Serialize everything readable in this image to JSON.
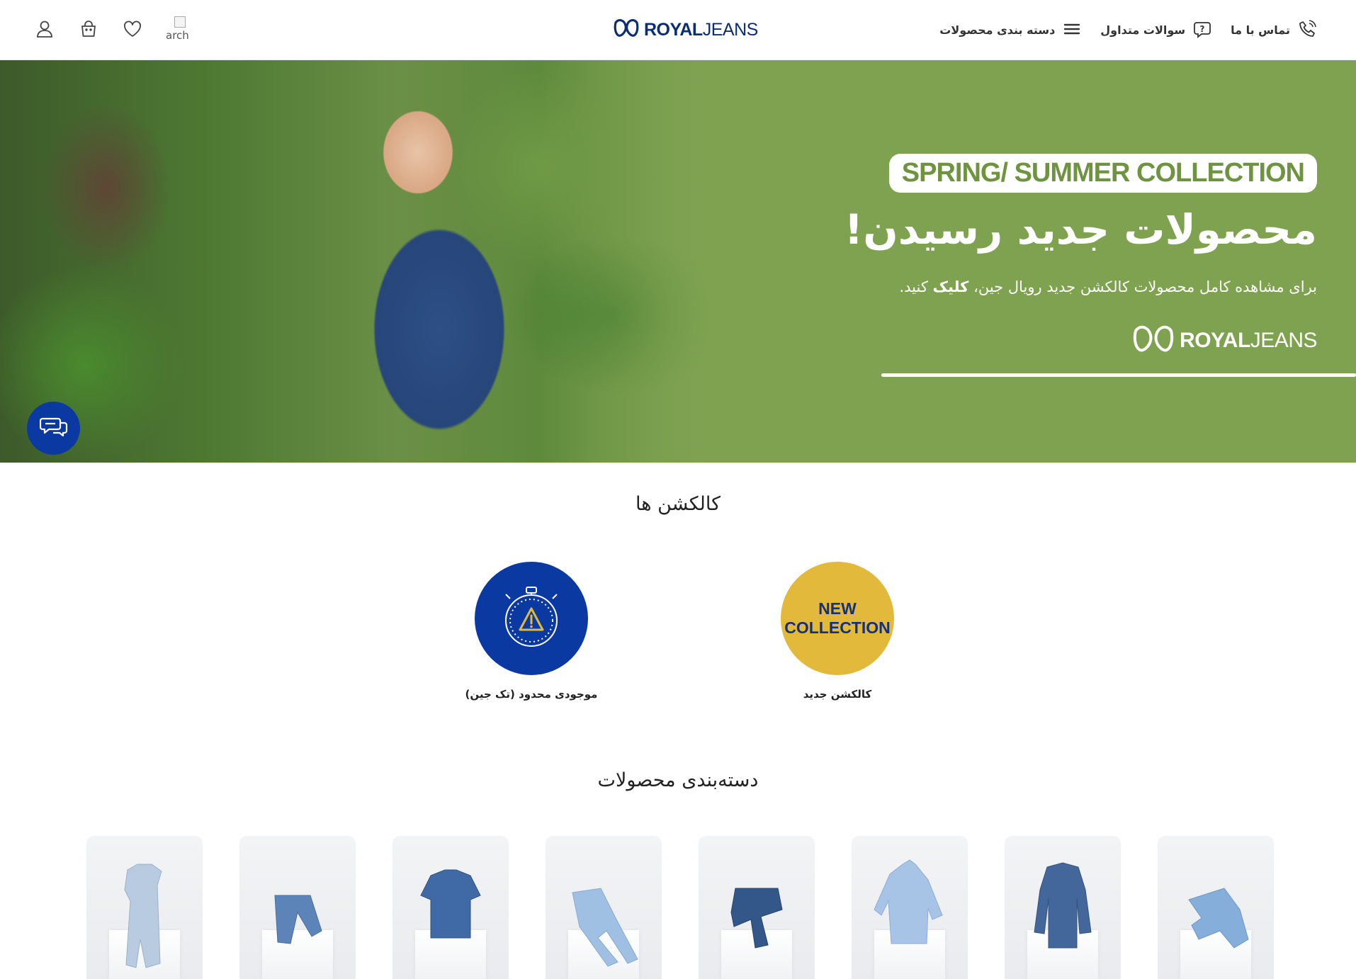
{
  "header": {
    "nav": [
      {
        "label": "دسته بندی محصولات",
        "icon": "hamburger-icon"
      },
      {
        "label": "سوالات متداول",
        "icon": "question-bubble-icon"
      },
      {
        "label": "تماس با ما",
        "icon": "phone-icon"
      }
    ],
    "logo": {
      "bold": "ROYAL",
      "light": "JEANS"
    },
    "search_alt": "arch",
    "actions": [
      "heart-icon",
      "basket-icon",
      "user-icon"
    ]
  },
  "hero": {
    "badge": "SPRING/ SUMMER COLLECTION",
    "title": "محصولات جدید رسیدن!",
    "subtitle_pre": "برای مشاهده کامل محصولات کالکشن جدید رویال جین،",
    "subtitle_bold": "کلیک",
    "subtitle_post": "کنید.",
    "logo": {
      "bold": "ROYAL",
      "light": "JEANS"
    },
    "bg_color": "#7ea250"
  },
  "collections": {
    "title": "کالکشن ها",
    "items": [
      {
        "label": "کالکشن جدید",
        "badge_line1": "NEW",
        "badge_line2": "COLLECTION",
        "color": "#e2b93b"
      },
      {
        "label": "موجودی محدود (تک جین)",
        "icon": "stopwatch-warning-icon",
        "color": "#0a3aa1"
      }
    ]
  },
  "categories": {
    "title": "دسته‌بندی محصولات",
    "items": [
      "long-denim-dress",
      "denim-shorts",
      "denim-short-sleeve-jacket",
      "light-skinny-jeans",
      "dark-jeans",
      "light-denim-shirt",
      "denim-jacket",
      "light-denim-skirt"
    ]
  },
  "colors": {
    "brand_navy": "#0b2e73",
    "accent_blue": "#0a3aa1",
    "accent_yellow": "#e2b93b",
    "hero_green": "#7ea250"
  }
}
